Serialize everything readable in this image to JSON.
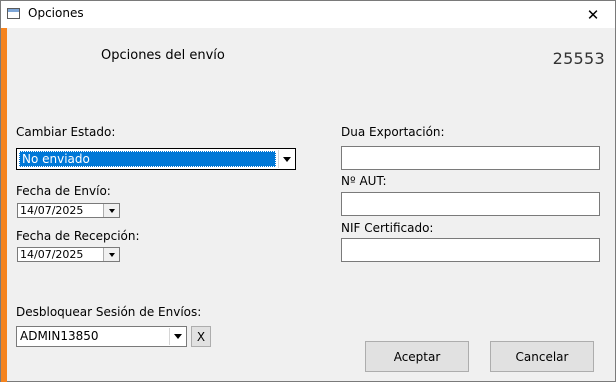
{
  "window": {
    "title": "Opciones",
    "close_glyph": "✕"
  },
  "header": {
    "title": "Opciones del envío",
    "number": "25553"
  },
  "left": {
    "estado_label": "Cambiar Estado:",
    "estado_value": "No enviado",
    "fecha_envio_label": "Fecha de Envío:",
    "fecha_envio_value": "14/07/2025",
    "fecha_recepcion_label": "Fecha de Recepción:",
    "fecha_recepcion_value": "14/07/2025",
    "desbloquear_label": "Desbloquear Sesión de Envíos:",
    "desbloquear_value": "ADMIN13850",
    "clear_label": "X"
  },
  "right": {
    "dua_label": "Dua Exportación:",
    "dua_value": "",
    "aut_label": "Nº AUT:",
    "aut_value": "",
    "nif_label": "NIF Certificado:",
    "nif_value": ""
  },
  "buttons": {
    "accept": "Aceptar",
    "cancel": "Cancelar"
  },
  "colors": {
    "accent": "#f5841f",
    "selection": "#0078d7"
  },
  "icons": {
    "app": "window-app-icon",
    "close": "close-icon",
    "dropdown": "chevron-down-icon"
  }
}
